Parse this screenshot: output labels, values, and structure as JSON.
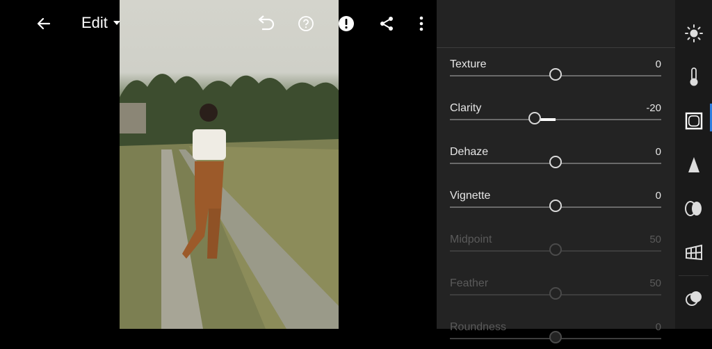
{
  "header": {
    "title": "Edit",
    "icons": [
      "back-arrow-icon",
      "undo-icon",
      "help-icon",
      "alert-icon",
      "share-icon",
      "more-vert-icon"
    ]
  },
  "sliders": [
    {
      "label": "Texture",
      "value": "0",
      "position": 0.5,
      "disabled": false
    },
    {
      "label": "Clarity",
      "value": "-20",
      "position": 0.4,
      "disabled": false
    },
    {
      "label": "Dehaze",
      "value": "0",
      "position": 0.5,
      "disabled": false
    },
    {
      "label": "Vignette",
      "value": "0",
      "position": 0.5,
      "disabled": false
    },
    {
      "label": "Midpoint",
      "value": "50",
      "position": 0.5,
      "disabled": true
    },
    {
      "label": "Feather",
      "value": "50",
      "position": 0.5,
      "disabled": true
    },
    {
      "label": "Roundness",
      "value": "0",
      "position": 0.5,
      "disabled": true
    }
  ],
  "rail": {
    "items": [
      "light-icon",
      "color-icon",
      "effects-icon",
      "detail-icon",
      "optics-icon",
      "geometry-icon",
      "presets-icon"
    ],
    "active": "effects-icon",
    "accent": "#2f7fe0"
  }
}
